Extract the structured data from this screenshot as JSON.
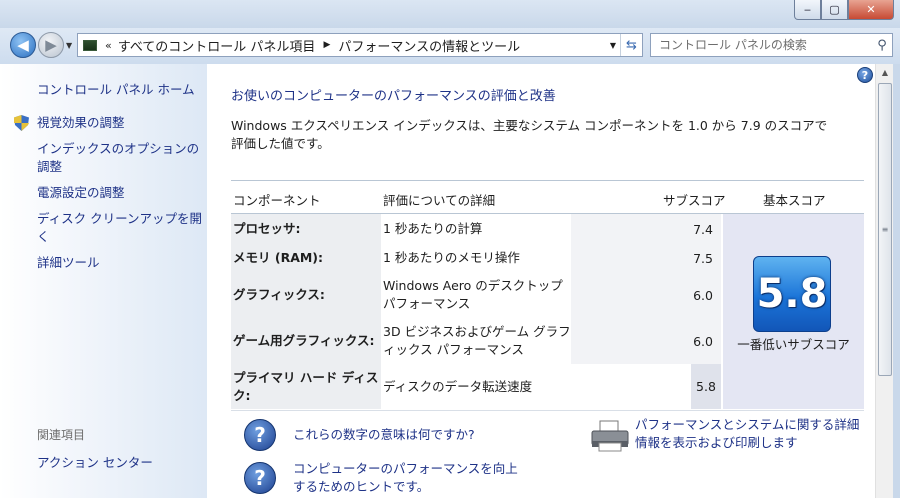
{
  "window": {
    "min_label": "‒",
    "max_label": "▢",
    "close_label": "✕"
  },
  "nav": {
    "back_glyph": "◀",
    "forward_glyph": "▶",
    "breadcrumb": [
      "すべてのコントロール パネル項目",
      "パフォーマンスの情報とツール"
    ],
    "breadcrumb_prefix": "«",
    "breadcrumb_arrow": "▶",
    "search_placeholder": "コントロール パネルの検索"
  },
  "sidebar": {
    "home": "コントロール パネル ホーム",
    "items": [
      {
        "label": "視覚効果の調整",
        "icon": "shield-icon"
      },
      {
        "label": "インデックスのオプションの調整"
      },
      {
        "label": "電源設定の調整"
      },
      {
        "label": "ディスク クリーンアップを開く"
      },
      {
        "label": "詳細ツール"
      }
    ],
    "related_heading": "関連項目",
    "related_link": "アクション センター"
  },
  "main": {
    "title": "お使いのコンピューターのパフォーマンスの評価と改善",
    "description": "Windows エクスペリエンス インデックスは、主要なシステム コンポーネントを 1.0 から 7.9 のスコアで評価した値です。",
    "table": {
      "headers": {
        "component": "コンポーネント",
        "detail": "評価についての詳細",
        "subscore": "サブスコア",
        "base": "基本スコア"
      },
      "rows": [
        {
          "component": "プロセッサ:",
          "detail": "1 秒あたりの計算",
          "subscore": "7.4"
        },
        {
          "component": "メモリ (RAM):",
          "detail": "1 秒あたりのメモリ操作",
          "subscore": "7.5"
        },
        {
          "component": "グラフィックス:",
          "detail": "Windows Aero のデスクトップ パフォーマンス",
          "subscore": "6.0"
        },
        {
          "component": "ゲーム用グラフィックス:",
          "detail": "3D ビジネスおよびゲーム グラフィックス パフォーマンス",
          "subscore": "6.0"
        },
        {
          "component": "プライマリ ハード ディスク:",
          "detail": "ディスクのデータ転送速度",
          "subscore": "5.8"
        }
      ],
      "base_score": "5.8",
      "base_score_label": "一番低いサブスコア"
    },
    "links": {
      "what_mean": "これらの数字の意味は何ですか?",
      "tips": "コンピューターのパフォーマンスを向上するためのヒントです。",
      "print": "パフォーマンスとシステムに関する詳細情報を表示および印刷します"
    }
  }
}
